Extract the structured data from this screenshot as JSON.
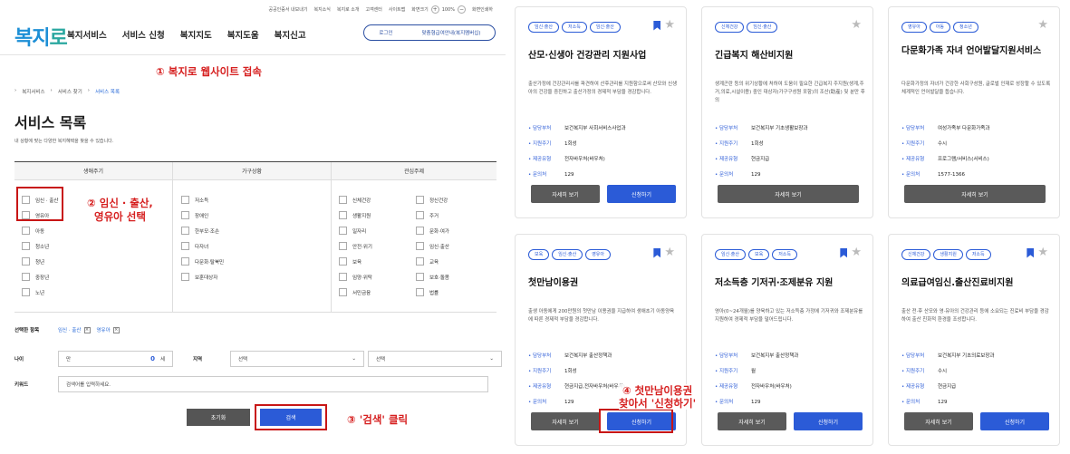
{
  "util": [
    "공공인증서 내보내기",
    "복지소식",
    "복지로 소개",
    "고객센터",
    "사이트맵",
    "화면크기",
    "100%",
    "화면인쇄하"
  ],
  "logo": {
    "a": "복지",
    "b": "로"
  },
  "gnb": [
    "복지서비스",
    "서비스 신청",
    "복지지도",
    "복지도움",
    "복지신고"
  ],
  "login": {
    "login": "로그인",
    "custom": "맞춤형급여안내(복지멤버십)"
  },
  "ann": {
    "a1": "① 복지로 웹사이트 접속",
    "a2l1": "② 임신 · 출산,",
    "a2l2": "영유아 선택",
    "a3": "③ '검색' 클릭",
    "a4l1": "④ 첫만남이용권",
    "a4l2": "찾아서 '신청하기'"
  },
  "crumb": [
    "복지서비스",
    "서비스 찾기",
    "서비스 목록"
  ],
  "page": {
    "title": "서비스 목록",
    "desc": "내 상황에 맞는 다양한 복지혜택을 찾을 수 있습니다."
  },
  "filter": {
    "heads": [
      "생애주기",
      "가구상황",
      "관심주제"
    ],
    "life": [
      "임신 · 출산",
      "영유아",
      "아동",
      "청소년",
      "청년",
      "중장년",
      "노년"
    ],
    "household": [
      "저소득",
      "장애인",
      "한부모·조손",
      "다자녀",
      "다문화·탈북민",
      "보훈대상자"
    ],
    "interest1": [
      "신체건강",
      "생활지원",
      "일자리",
      "안전·위기",
      "보육",
      "임양·위탁",
      "서민금융"
    ],
    "interest2": [
      "정신건강",
      "주거",
      "문화·여가",
      "임신·출산",
      "교육",
      "보호·돌봄",
      "법률"
    ]
  },
  "selected": {
    "label": "선택한 항목",
    "items": [
      "임신 · 출산",
      "영유아"
    ]
  },
  "age": {
    "label": "나이",
    "prefix": "만",
    "value": "0",
    "unit": "세"
  },
  "region": {
    "label": "지역",
    "sel1": "선택",
    "sel2": "선택"
  },
  "keyword": {
    "label": "키워드",
    "placeholder": "검색어를 입력하세요."
  },
  "buttons": {
    "reset": "초기화",
    "search": "검색"
  },
  "cards": [
    {
      "tags": [
        "임신·출산",
        "저소득",
        "임신·출산"
      ],
      "title": "산모·신생아 건강관리 지원사업",
      "desc": "출산가정에 건강관리사를 파견하여 산후관리를 지원함으로써 산모와 신생아의 건강을 증진하고 출산가정의 경제적 부담을 경감합니다.",
      "dept": "보건복지부 사회서비스사업과",
      "cycle": "1회성",
      "type": "전자바우처(바우처)",
      "tel": "129",
      "bookmark": true,
      "two": true
    },
    {
      "tags": [
        "신체건강",
        "임신·출산"
      ],
      "title": "긴급복지 해산비지원",
      "desc": "생계곤란 등의 위기상황에 처하여 도움이 필요한 긴급복지 주지원(생계,주거,의료,시설이용) 중인 대상자(가구구성원 포함)의 조산(助産) 및 분만 후의",
      "dept": "보건복지부 기초생활보장과",
      "cycle": "1회성",
      "type": "현금지급",
      "tel": "129",
      "bookmark": false,
      "two": false
    },
    {
      "tags": [
        "영유아",
        "아동",
        "청소년"
      ],
      "title": "다문화가족 자녀 언어발달지원서비스",
      "desc": "다문화가정의 자녀가 건강한 사회구성원, 글로벌 인재로 성장할 수 있도록 체계적인 언어발달을 돕습니다.",
      "dept": "여성가족부 다문화가족과",
      "cycle": "수시",
      "type": "프로그램/서비스(서비스)",
      "tel": "1577-1366",
      "bookmark": false,
      "two": false
    },
    {
      "tags": [
        "보육",
        "임신·출산",
        "영유아"
      ],
      "title": "첫만남이용권",
      "desc": "출생 아동에게 200만원의 첫만남 이용권을 지급하여 생애초기 아동양육에 따른 경제적 부담을 경감합니다.",
      "dept": "보건복지부 출산정책과",
      "cycle": "1회성",
      "type": "현금지급,전자바우처(바우처)",
      "tel": "129",
      "bookmark": true,
      "two": true
    },
    {
      "tags": [
        "임신·출산",
        "보육",
        "저소득"
      ],
      "title": "저소득층 기저귀·조제분유 지원",
      "desc": "영아(0~24개월)를 양육하고 있는 저소득층 가정에 기저귀와 조제분유를 지원하여 경제적 부담을 덜어드립니다.",
      "dept": "보건복지부 출산정책과",
      "cycle": "월",
      "type": "전자바우처(바우처)",
      "tel": "129",
      "bookmark": true,
      "two": true
    },
    {
      "tags": [
        "신체건강",
        "생활지원",
        "저소득"
      ],
      "title": "의료급여임신.출산진료비지원",
      "desc": "출산 전·후 산모와 영·유아의 건강관리 등에 소요되는 진료비 부담을 경감하여 출산 친화적 환경을 조성합니다.",
      "dept": "보건복지부 기초의료보장과",
      "cycle": "수시",
      "type": "현금지급",
      "tel": "129",
      "bookmark": true,
      "two": true
    }
  ],
  "labels": {
    "dept": "담당부처",
    "cycle": "지원주기",
    "type": "제공유형",
    "tel": "문의처",
    "detail": "자세히 보기",
    "apply": "신청하기"
  },
  "colors": {
    "accent": "#2b5bd7",
    "annotation": "#d62020"
  }
}
